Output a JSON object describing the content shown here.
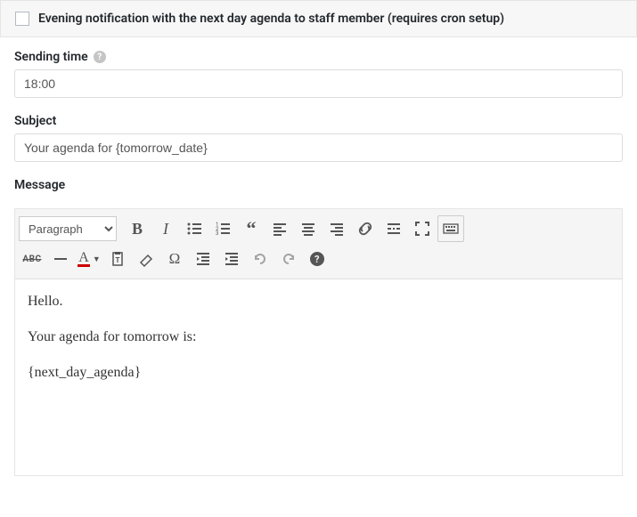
{
  "header": {
    "checkbox_label": "Evening notification with the next day agenda to staff member (requires cron setup)"
  },
  "sending_time": {
    "label": "Sending time",
    "value": "18:00"
  },
  "subject": {
    "label": "Subject",
    "value": "Your agenda for {tomorrow_date}"
  },
  "message": {
    "label": "Message"
  },
  "editor": {
    "format_selected": "Paragraph",
    "content_p1": "Hello.",
    "content_p2": "Your agenda for tomorrow is:",
    "content_p3": "{next_day_agenda}"
  }
}
